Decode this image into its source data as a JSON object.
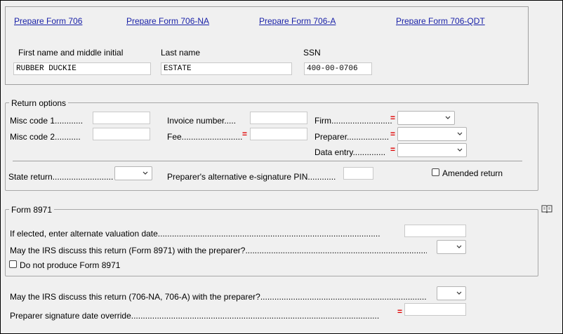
{
  "links": {
    "form706": "Prepare Form 706",
    "form706na": "Prepare Form 706-NA",
    "form706a": "Prepare Form 706-A",
    "form706qdt": "Prepare Form 706-QDT"
  },
  "taxpayer": {
    "first_name_label": "First name and middle initial",
    "first_name_value": "RUBBER DUCKIE",
    "last_name_label": "Last name",
    "last_name_value": "ESTATE",
    "ssn_label": "SSN",
    "ssn_value": "400-00-0706"
  },
  "return_options": {
    "title": "Return options",
    "misc1_label": "Misc code 1............",
    "misc2_label": "Misc code 2...........",
    "invoice_label": "Invoice number.....",
    "fee_label": "Fee..........................",
    "firm_label": "Firm..........................",
    "preparer_label": "Preparer..................",
    "data_entry_label": "Data entry..............",
    "state_return_label": "State return..........................",
    "alt_pin_label": "Preparer's alternative e-signature PIN............",
    "amended_label": "Amended return",
    "required_marker": "="
  },
  "form8971": {
    "title": "Form 8971",
    "alt_valuation_label": "If elected, enter alternate valuation date...............................................................................................",
    "irs_discuss_label": "May the IRS discuss this return (Form 8971) with the preparer?..........................................................................................",
    "do_not_produce_label": "Do not produce Form 8971"
  },
  "bottom": {
    "irs_discuss_label": "May the IRS discuss this return (706-NA, 706-A) with the preparer?..............................................................................",
    "sig_date_label": "Preparer signature date override..........................................................................................................",
    "required_marker": "="
  },
  "icons": {
    "help": "book-icon"
  }
}
